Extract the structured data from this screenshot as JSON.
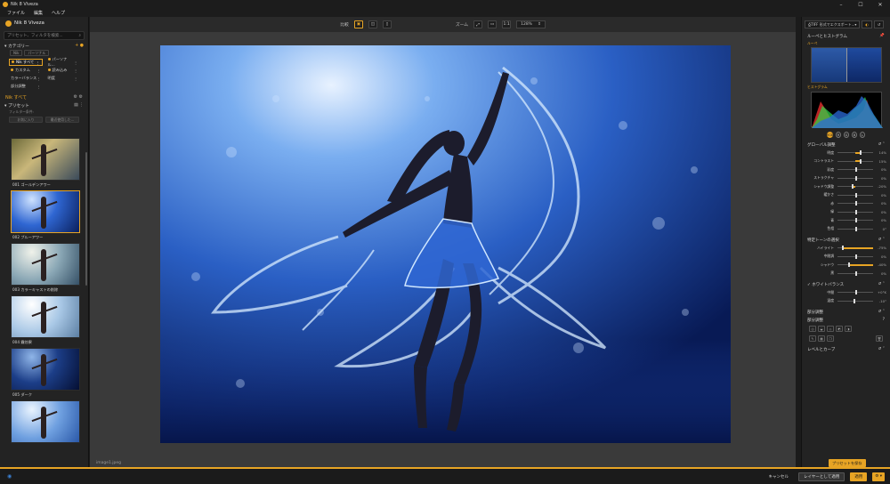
{
  "window": {
    "title": "Nik 8 Viveza"
  },
  "menu": [
    "ファイル",
    "編集",
    "ヘルプ"
  ],
  "left": {
    "app_name": "Nik 8 Viveza",
    "search_placeholder": "プリセット、フィルタを検索...",
    "category_title": "カテゴリー",
    "chips": [
      "Nik",
      "パーソナル"
    ],
    "categories": [
      {
        "label": "Nik すべて",
        "selected": true
      },
      {
        "label": "パーソナル..."
      },
      {
        "label": "カスタム"
      },
      {
        "label": "読み込み"
      },
      {
        "label": "カラーバランス"
      },
      {
        "label": "明度"
      },
      {
        "label": "部分調整"
      }
    ],
    "nik_all": "Nik すべて",
    "presets_title": "プリセット",
    "filter_label": "フィルター条件:",
    "tool_buttons": [
      "お気に入り",
      "最近使用した..."
    ],
    "presets": [
      {
        "label": "001 ゴールデンアワー",
        "tone": "golden"
      },
      {
        "label": "002 ブルーアワー",
        "tone": "blue",
        "selected": true
      },
      {
        "label": "003 カラーキャストの削除",
        "tone": "neutral"
      },
      {
        "label": "004 霧効果",
        "tone": "fog"
      },
      {
        "label": "005 ダーク",
        "tone": "dark"
      },
      {
        "label": "",
        "tone": "light"
      }
    ]
  },
  "center": {
    "compare_label": "比較",
    "zoom_label": "ズーム",
    "zoom_one": "1:1",
    "zoom_value": "128%",
    "filename": "image1.jpeg"
  },
  "right": {
    "export_label": "TIFF 形式でエクスポート...",
    "loupe_title": "ルーペとヒストグラム",
    "loupe_sub": "ルーペ",
    "hist_sub": "ヒストグラム",
    "channels": [
      "RGB",
      "R",
      "G",
      "B",
      "L"
    ],
    "global_title": "グローバル調整",
    "global_sliders": [
      {
        "label": "明度",
        "value": "14%",
        "pos": 0.62
      },
      {
        "label": "コントラスト",
        "value": "15%",
        "pos": 0.62
      },
      {
        "label": "彩度",
        "value": "0%",
        "pos": 0.5
      },
      {
        "label": "ストラクチャ",
        "value": "0%",
        "pos": 0.5
      },
      {
        "label": "シャドウ調整",
        "value": "-20%",
        "pos": 0.4
      },
      {
        "label": "暖かさ",
        "value": "0%",
        "pos": 0.5
      },
      {
        "label": "赤",
        "value": "0%",
        "pos": 0.5
      },
      {
        "label": "緑",
        "value": "0%",
        "pos": 0.5
      },
      {
        "label": "青",
        "value": "0%",
        "pos": 0.5
      },
      {
        "label": "色相",
        "value": "0°",
        "pos": 0.5
      }
    ],
    "tone_title": "特定トーンの選択",
    "tone_sliders": [
      {
        "label": "ハイライト",
        "value": "-75%",
        "pos": 0.12,
        "fill": true
      },
      {
        "label": "中間調",
        "value": "0%",
        "pos": 0.5
      },
      {
        "label": "シャドウ",
        "value": "-40%",
        "pos": 0.3,
        "fill": true
      },
      {
        "label": "黒",
        "value": "0%",
        "pos": 0.5
      }
    ],
    "wb_title": "ホワイトバランス",
    "wb_sliders": [
      {
        "label": "中間",
        "value": "+0°K",
        "pos": 0.5
      },
      {
        "label": "温度",
        "value": "-10°",
        "pos": 0.45
      }
    ],
    "local_title": "部分調整",
    "local_sub": "部分調整",
    "levels_title": "レベルとカーブ",
    "save_preset": "プリセットを保存"
  },
  "bottom": {
    "cancel": "キャンセル",
    "apply_layer": "レイヤーとして適用",
    "apply": "適用"
  },
  "colors": {
    "accent": "#e7a424",
    "panel": "#232323",
    "canvas": "#3a3a3a"
  }
}
